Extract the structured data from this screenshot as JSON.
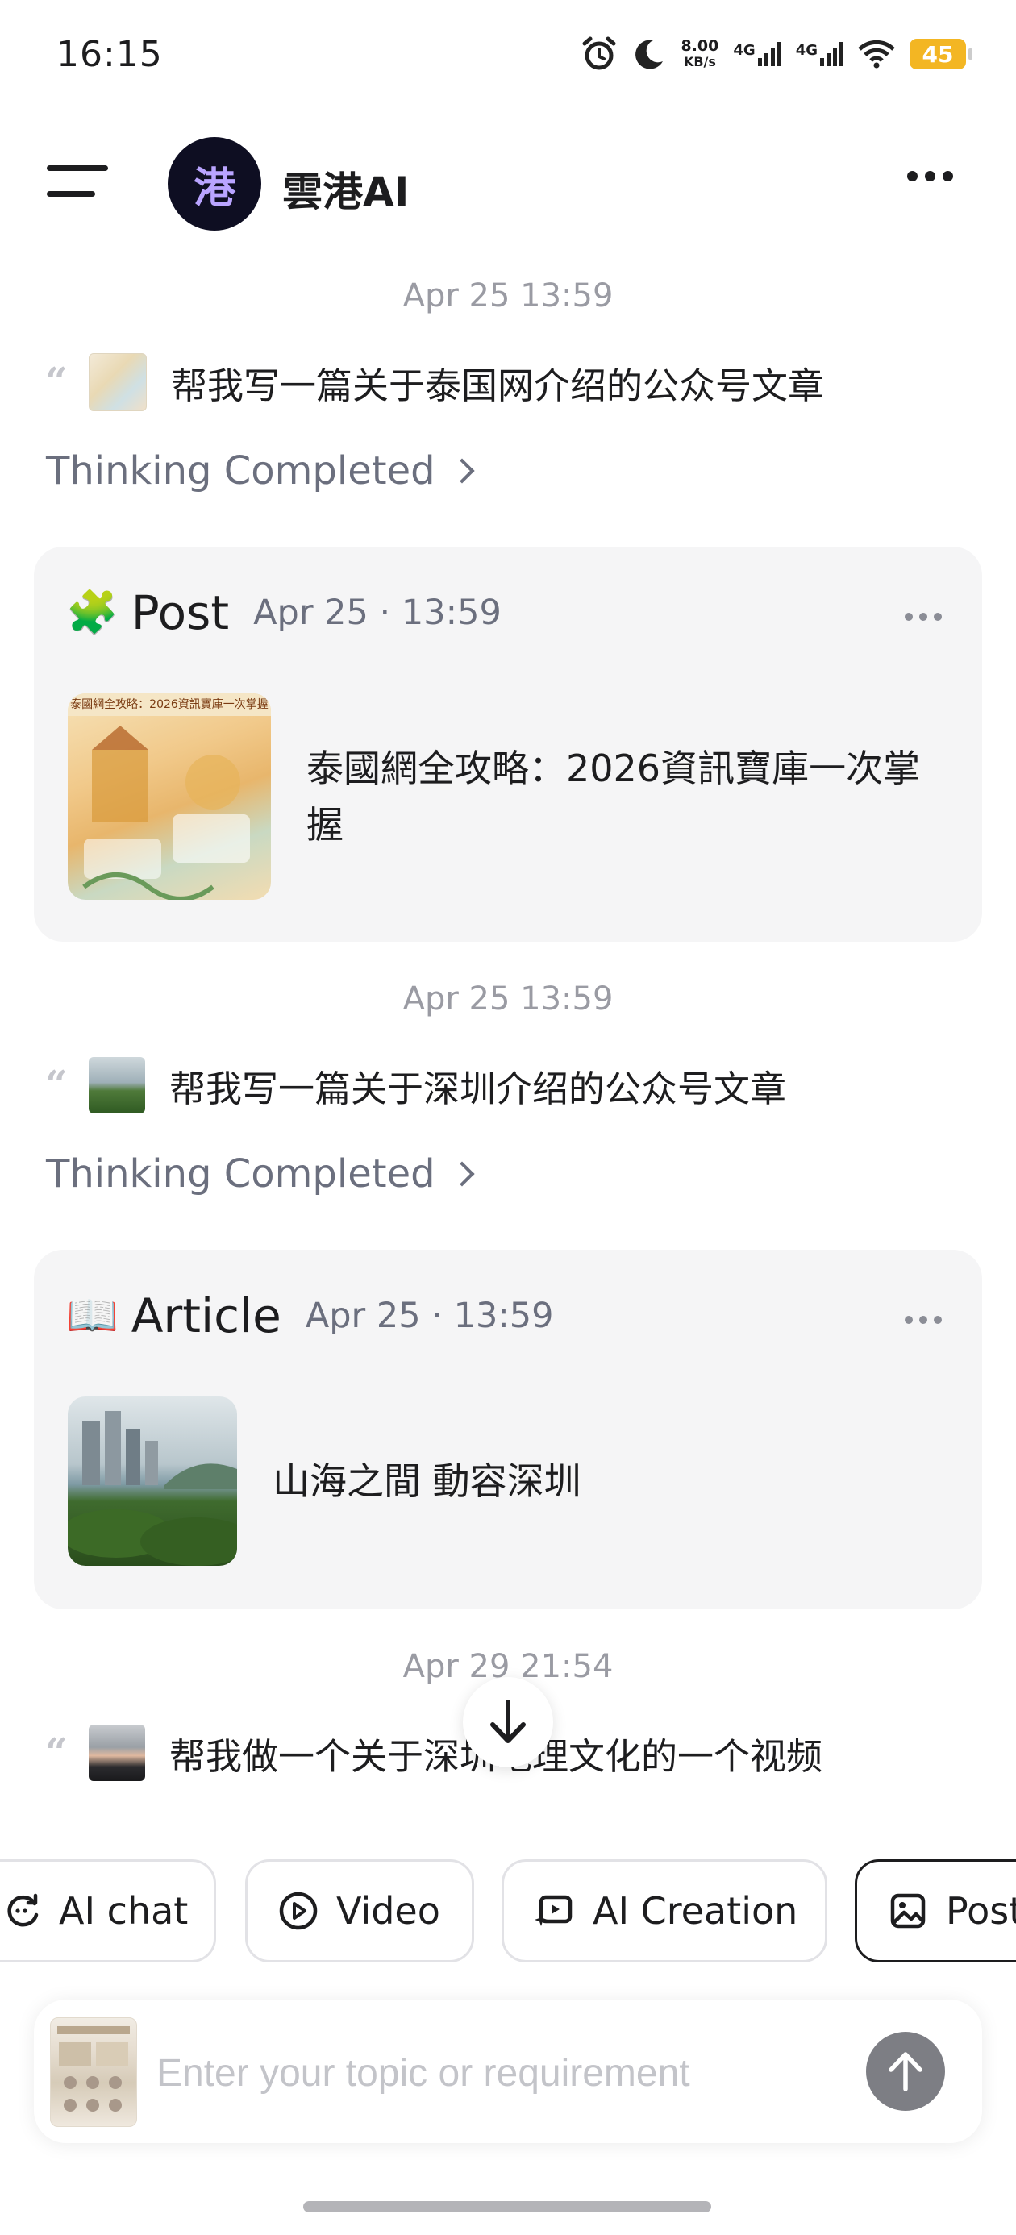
{
  "status_bar": {
    "time": "16:15",
    "net_speed_value": "8.00",
    "net_speed_unit": "KB/s",
    "sim1": "4G",
    "sim2": "4G",
    "battery": "45",
    "icons": [
      "alarm-icon",
      "moon-icon",
      "signal-icon",
      "signal-icon",
      "wifi-icon",
      "battery-icon"
    ]
  },
  "header": {
    "app_avatar_text": "港",
    "app_name": "雲港AI"
  },
  "conversation": [
    {
      "timestamp": "Apr 25 13:59",
      "prompt": "帮我写一篇关于泰国网介绍的公众号文章",
      "thinking": "Thinking Completed",
      "card": {
        "type": "Post",
        "icon": "puzzle-icon",
        "date": "Apr 25 · 13:59",
        "title": "泰國網全攻略：2026資訊寶庫一次掌握",
        "thumb_caption": "泰國網全攻略：2026資訊寶庫一次掌握"
      }
    },
    {
      "timestamp": "Apr 25 13:59",
      "prompt": "帮我写一篇关于深圳介绍的公众号文章",
      "thinking": "Thinking Completed",
      "card": {
        "type": "Article",
        "icon": "book-icon",
        "date": "Apr 25 · 13:59",
        "title": "山海之間 動容深圳"
      }
    },
    {
      "timestamp": "Apr 29 21:54",
      "prompt": "帮我做一个关于深圳地理文化的一个视频"
    }
  ],
  "chips": [
    {
      "label": "AI chat",
      "icon": "chat-refresh-icon"
    },
    {
      "label": "Video",
      "icon": "play-circle-icon"
    },
    {
      "label": "AI Creation",
      "icon": "ai-creation-icon"
    },
    {
      "label": "Post",
      "icon": "image-icon",
      "selected": true
    }
  ],
  "composer": {
    "placeholder": "Enter your topic or requirement"
  },
  "colors": {
    "card_bg": "#f5f5f6",
    "muted_text": "#6b6f7e",
    "timestamp": "#9a9ba3",
    "send_button": "#7d7e84",
    "battery": "#f3b623"
  }
}
